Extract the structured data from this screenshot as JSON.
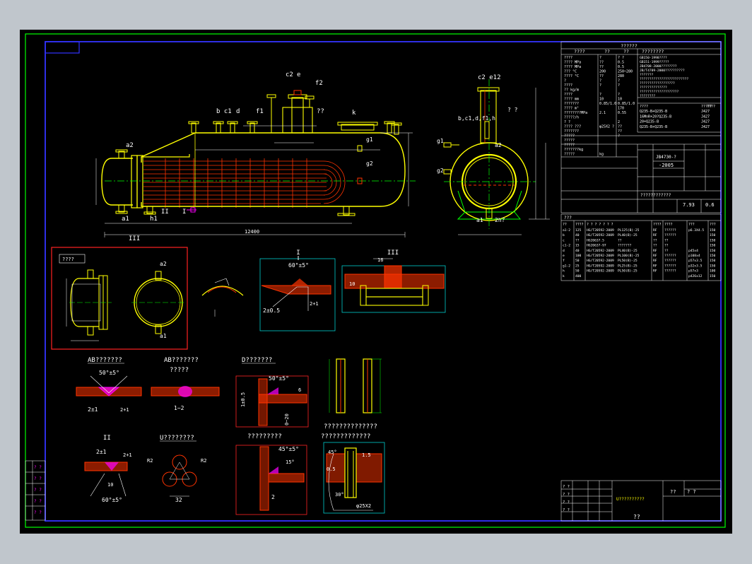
{
  "colors": {
    "background": "#000000",
    "frame_outer": "#00ff00",
    "frame_inner": "#3333ff",
    "shell": "#ffff00",
    "tubes": "#ff3300",
    "dims": "#ffffff",
    "centerline": "#00ff00",
    "detail_box": "#00cccc",
    "red_box": "#ff2222",
    "magenta": "#ff00ff"
  },
  "labels": {
    "a2": "a2",
    "c2": "c2",
    "e": "e",
    "f2": "f2",
    "bc1": "b c1",
    "d": "d",
    "f1": "f1",
    "qq": "??",
    "k": "k",
    "g1": "g1",
    "g2": "g2",
    "a1": "a1",
    "h1": "h1",
    "III": "III",
    "II": "II",
    "I": "I",
    "side_c2e12": "c2  e12",
    "side_bcd": "b,c1,d,f1,h",
    "side_qq": "? ?",
    "side_a1": "a1",
    "side_h2": "2h?",
    "side_a2": "a2",
    "dim_main": "12400"
  },
  "details": {
    "box_title": "????",
    "box_a2": "a2",
    "box_a1": "a1",
    "I_title": "I",
    "I_angle": "60°±5°",
    "I_gap": "2±0.5",
    "I_t": "2+1",
    "III_title": "III",
    "III_dim": "16",
    "III_dim2": "10",
    "AB1_title": "AB???????",
    "AB1_angle": "50°±5°",
    "AB1_gap": "2±1",
    "AB1_t": "2+1",
    "AB2_title": "AB???????",
    "AB2_sub": "?????",
    "AB2_gap": "1~2",
    "D_title": "D???????",
    "D_angle": "50°±5°",
    "D_dim1": "1±0.5",
    "D_dim2": "0~20",
    "D_dim3": "6",
    "II_title": "II",
    "II_gap": "2±1",
    "II_t": "2+1",
    "II_dim": "10",
    "II_angle": "60°±5°",
    "U_title": "U????????",
    "U_dim": "32",
    "U_r1": "R2",
    "U_r2": "R2",
    "W_title": "?????????",
    "W_angle": "45°±5°",
    "W_angle2": "15°",
    "W_dim": "2",
    "T_title1": "??????????????",
    "T_title2": "?????????????",
    "T_angle": "45°",
    "T_dim1": "1.5",
    "T_dim2": "30°",
    "T_phi": "φ25X2",
    "T_dim3": "0.5"
  },
  "spec_table": {
    "title": "??????",
    "header_left": "????",
    "header_col1": "??",
    "header_col2": "??",
    "header_right": "????????",
    "rows": [
      [
        "????",
        "?",
        "?  ?"
      ],
      [
        "????  MPa",
        "??",
        "0.5"
      ],
      [
        "????  MPa",
        "??",
        "0.5"
      ],
      [
        "???  °C",
        "200",
        "250~280"
      ],
      [
        "????  °C",
        "??",
        "280"
      ],
      [
        "?",
        "?",
        "?"
      ],
      [
        "????  ",
        "?",
        "?"
      ],
      [
        "?? kg/m",
        "",
        ""
      ],
      [
        "????",
        "?",
        "?"
      ],
      [
        "????   mm",
        "10",
        "10"
      ],
      [
        "???????",
        "0.85/1.0",
        "0.85/1.0"
      ],
      [
        "???? m²",
        "",
        "170"
      ],
      [
        "????????MPa",
        "2.1",
        "0.55"
      ],
      [
        "?????/h",
        "",
        ""
      ],
      [
        "? ?",
        "",
        "2"
      ],
      [
        "???? ???",
        "φ25X2 ?",
        "??"
      ],
      [
        "???????",
        "",
        "??"
      ],
      [
        "?????",
        "",
        "?"
      ],
      [
        "?????",
        "",
        ""
      ],
      [
        "?????",
        "",
        ""
      ],
      [
        "???????kg",
        "",
        ""
      ],
      [
        "?????",
        "kg",
        ""
      ]
    ],
    "notes": [
      "GB150-1998????",
      "GB151-1999?????",
      "JB4708-2000????????",
      "JB/T4709-2000??????????",
      "???????",
      "?????????????????????????",
      "??????????????????",
      "??????????????",
      "????????????????????",
      "????????"
    ],
    "mat_rows": [
      [
        "????",
        "?????",
        "????"
      ],
      [
        "Q235-B+Q235-B",
        "J427"
      ],
      [
        "16MnR+20?Q235-B",
        "J427"
      ],
      [
        "20+Q235-B",
        "J427"
      ],
      [
        "Q235-B+Q235-B",
        "J427"
      ]
    ],
    "std_label": "JB4730-?",
    "std_num": "-2005",
    "std_row": "????????????",
    "pressure": "7.93",
    "pressure2": "0.6"
  },
  "nozzle_table": {
    "title": "???",
    "headers": [
      "??",
      "????",
      "? ? ? ? ? ? ?",
      "????",
      "????",
      "???",
      "???"
    ],
    "rows": [
      [
        "a1-2",
        "125",
        "HG/T20592-2009",
        "PL125(B)-25",
        "RF",
        "??????",
        "p6.3X4.5",
        "150"
      ],
      [
        "b",
        "40",
        "HG/T20592-2009",
        "PL40(B)-25",
        "RF",
        "??????",
        "",
        "150"
      ],
      [
        "c",
        "??",
        "HG20637.5",
        "??",
        "??",
        "??",
        "",
        "150"
      ],
      [
        "c1-2",
        "15",
        "HG20637-97",
        "???????",
        "??",
        "??",
        "",
        "150"
      ],
      [
        "d",
        "40",
        "HG/T20592-2009",
        "PL40(B)-25",
        "RF",
        "??",
        "p45x4",
        "150"
      ],
      [
        "e",
        "100",
        "HG/T20592-2009",
        "PL100(B)-25",
        "RF",
        "??????",
        "p108x4",
        "150"
      ],
      [
        "f",
        "50",
        "HG/T20592-2009",
        "PL50(B)-25",
        "RF",
        "??????",
        "p57x3.5",
        "150"
      ],
      [
        "g1-2",
        "25",
        "HG/T20592-2009",
        "PL25(B)-25",
        "RF",
        "??????",
        "p32x3.5",
        "150"
      ],
      [
        "h",
        "50",
        "HG/T20592-2009",
        "PL50(B)-25",
        "RF",
        "??????",
        "p57x3",
        "100"
      ],
      [
        "k",
        "400",
        "",
        "",
        "",
        "",
        "p426x12",
        "150"
      ]
    ]
  },
  "title_block": {
    "drawing_name": "U??????????",
    "label1": "??",
    "label2": "? ?",
    "rows": [
      "? ?",
      "? ?",
      "? ?",
      "? ?"
    ],
    "bottom": "??"
  },
  "left_strip": [
    "? ?",
    "? ?",
    "? ?",
    "? ?",
    "? ?"
  ]
}
